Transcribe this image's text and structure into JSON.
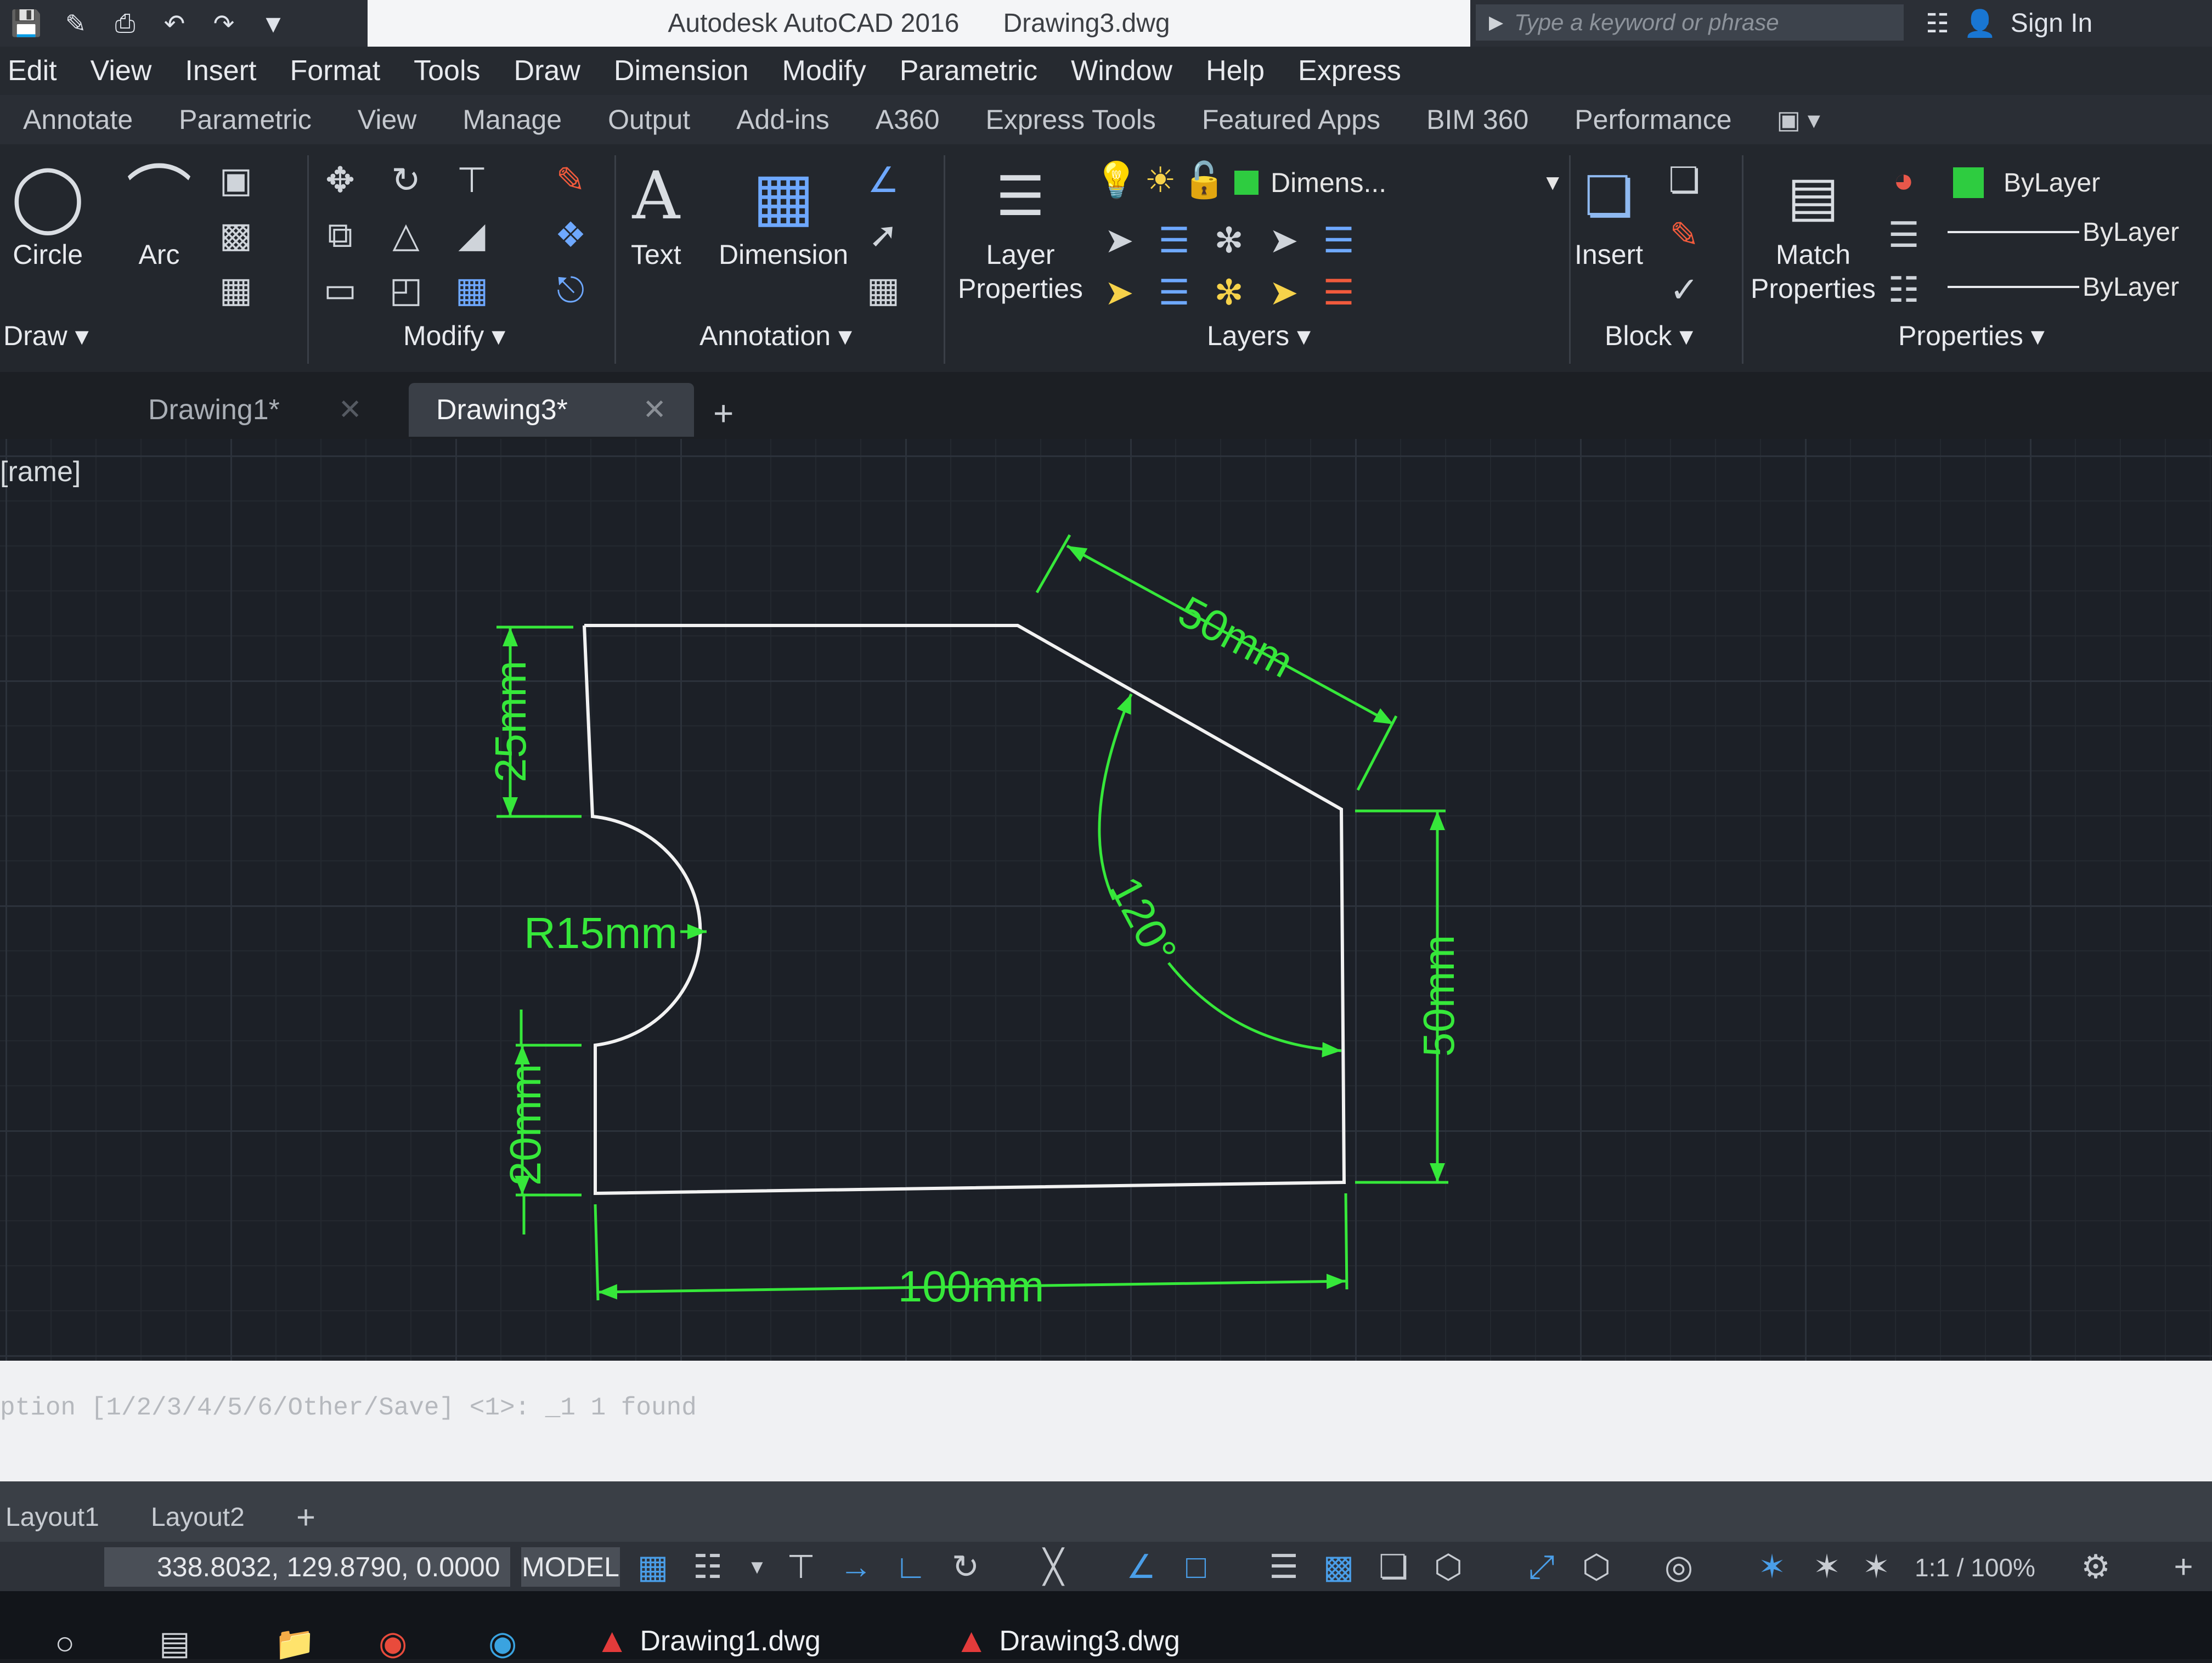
{
  "window": {
    "app_title": "Autodesk AutoCAD 2016",
    "file_name": "Drawing3.dwg",
    "search_placeholder": "Type a keyword or phrase",
    "sign_in": "Sign In"
  },
  "menus": [
    "Edit",
    "View",
    "Insert",
    "Format",
    "Tools",
    "Draw",
    "Dimension",
    "Modify",
    "Parametric",
    "Window",
    "Help",
    "Express"
  ],
  "ribbon_tabs": [
    "Annotate",
    "Parametric",
    "View",
    "Manage",
    "Output",
    "Add-ins",
    "A360",
    "Express Tools",
    "Featured Apps",
    "BIM 360",
    "Performance"
  ],
  "ribbon": {
    "draw": {
      "title": "Draw",
      "circle": "Circle",
      "arc": "Arc"
    },
    "modify": {
      "title": "Modify"
    },
    "annotation": {
      "title": "Annotation",
      "text": "Text",
      "dimension": "Dimension"
    },
    "layers": {
      "title": "Layers",
      "layer_properties": "Layer Properties",
      "current_layer": "Dimens..."
    },
    "block": {
      "title": "Block",
      "insert": "Insert"
    },
    "properties": {
      "title": "Properties",
      "match": "Match Properties",
      "color": "ByLayer",
      "linetype": "ByLayer",
      "lineweight": "ByLayer"
    }
  },
  "doc_tabs": [
    {
      "label": "Drawing1*",
      "active": false
    },
    {
      "label": "Drawing3*",
      "active": true
    }
  ],
  "viewport_label": "[rame]",
  "drawing": {
    "dim_top_left": "25mm",
    "dim_radius": "R15mm",
    "dim_bottom_left": "20mm",
    "dim_bottom": "100mm",
    "dim_right": "50mm",
    "dim_slope": "50mm",
    "dim_angle": "120°",
    "shape_color": "#f2f2f2",
    "dim_color": "#36e83a"
  },
  "command_line": "ption [1/2/3/4/5/6/Other/Save] <1>: _1 1 found",
  "layout_tabs": [
    "Layout1",
    "Layout2"
  ],
  "status": {
    "coordinates": "338.8032, 129.8790, 0.0000",
    "model": "MODEL",
    "scale": "1:1 / 100%"
  },
  "taskbar": [
    "Drawing1.dwg",
    "Drawing3.dwg"
  ],
  "colors": {
    "accent": "#4a9ee8",
    "layer_swatch": "#2ecc40",
    "tab_active": "#3a3f47"
  }
}
